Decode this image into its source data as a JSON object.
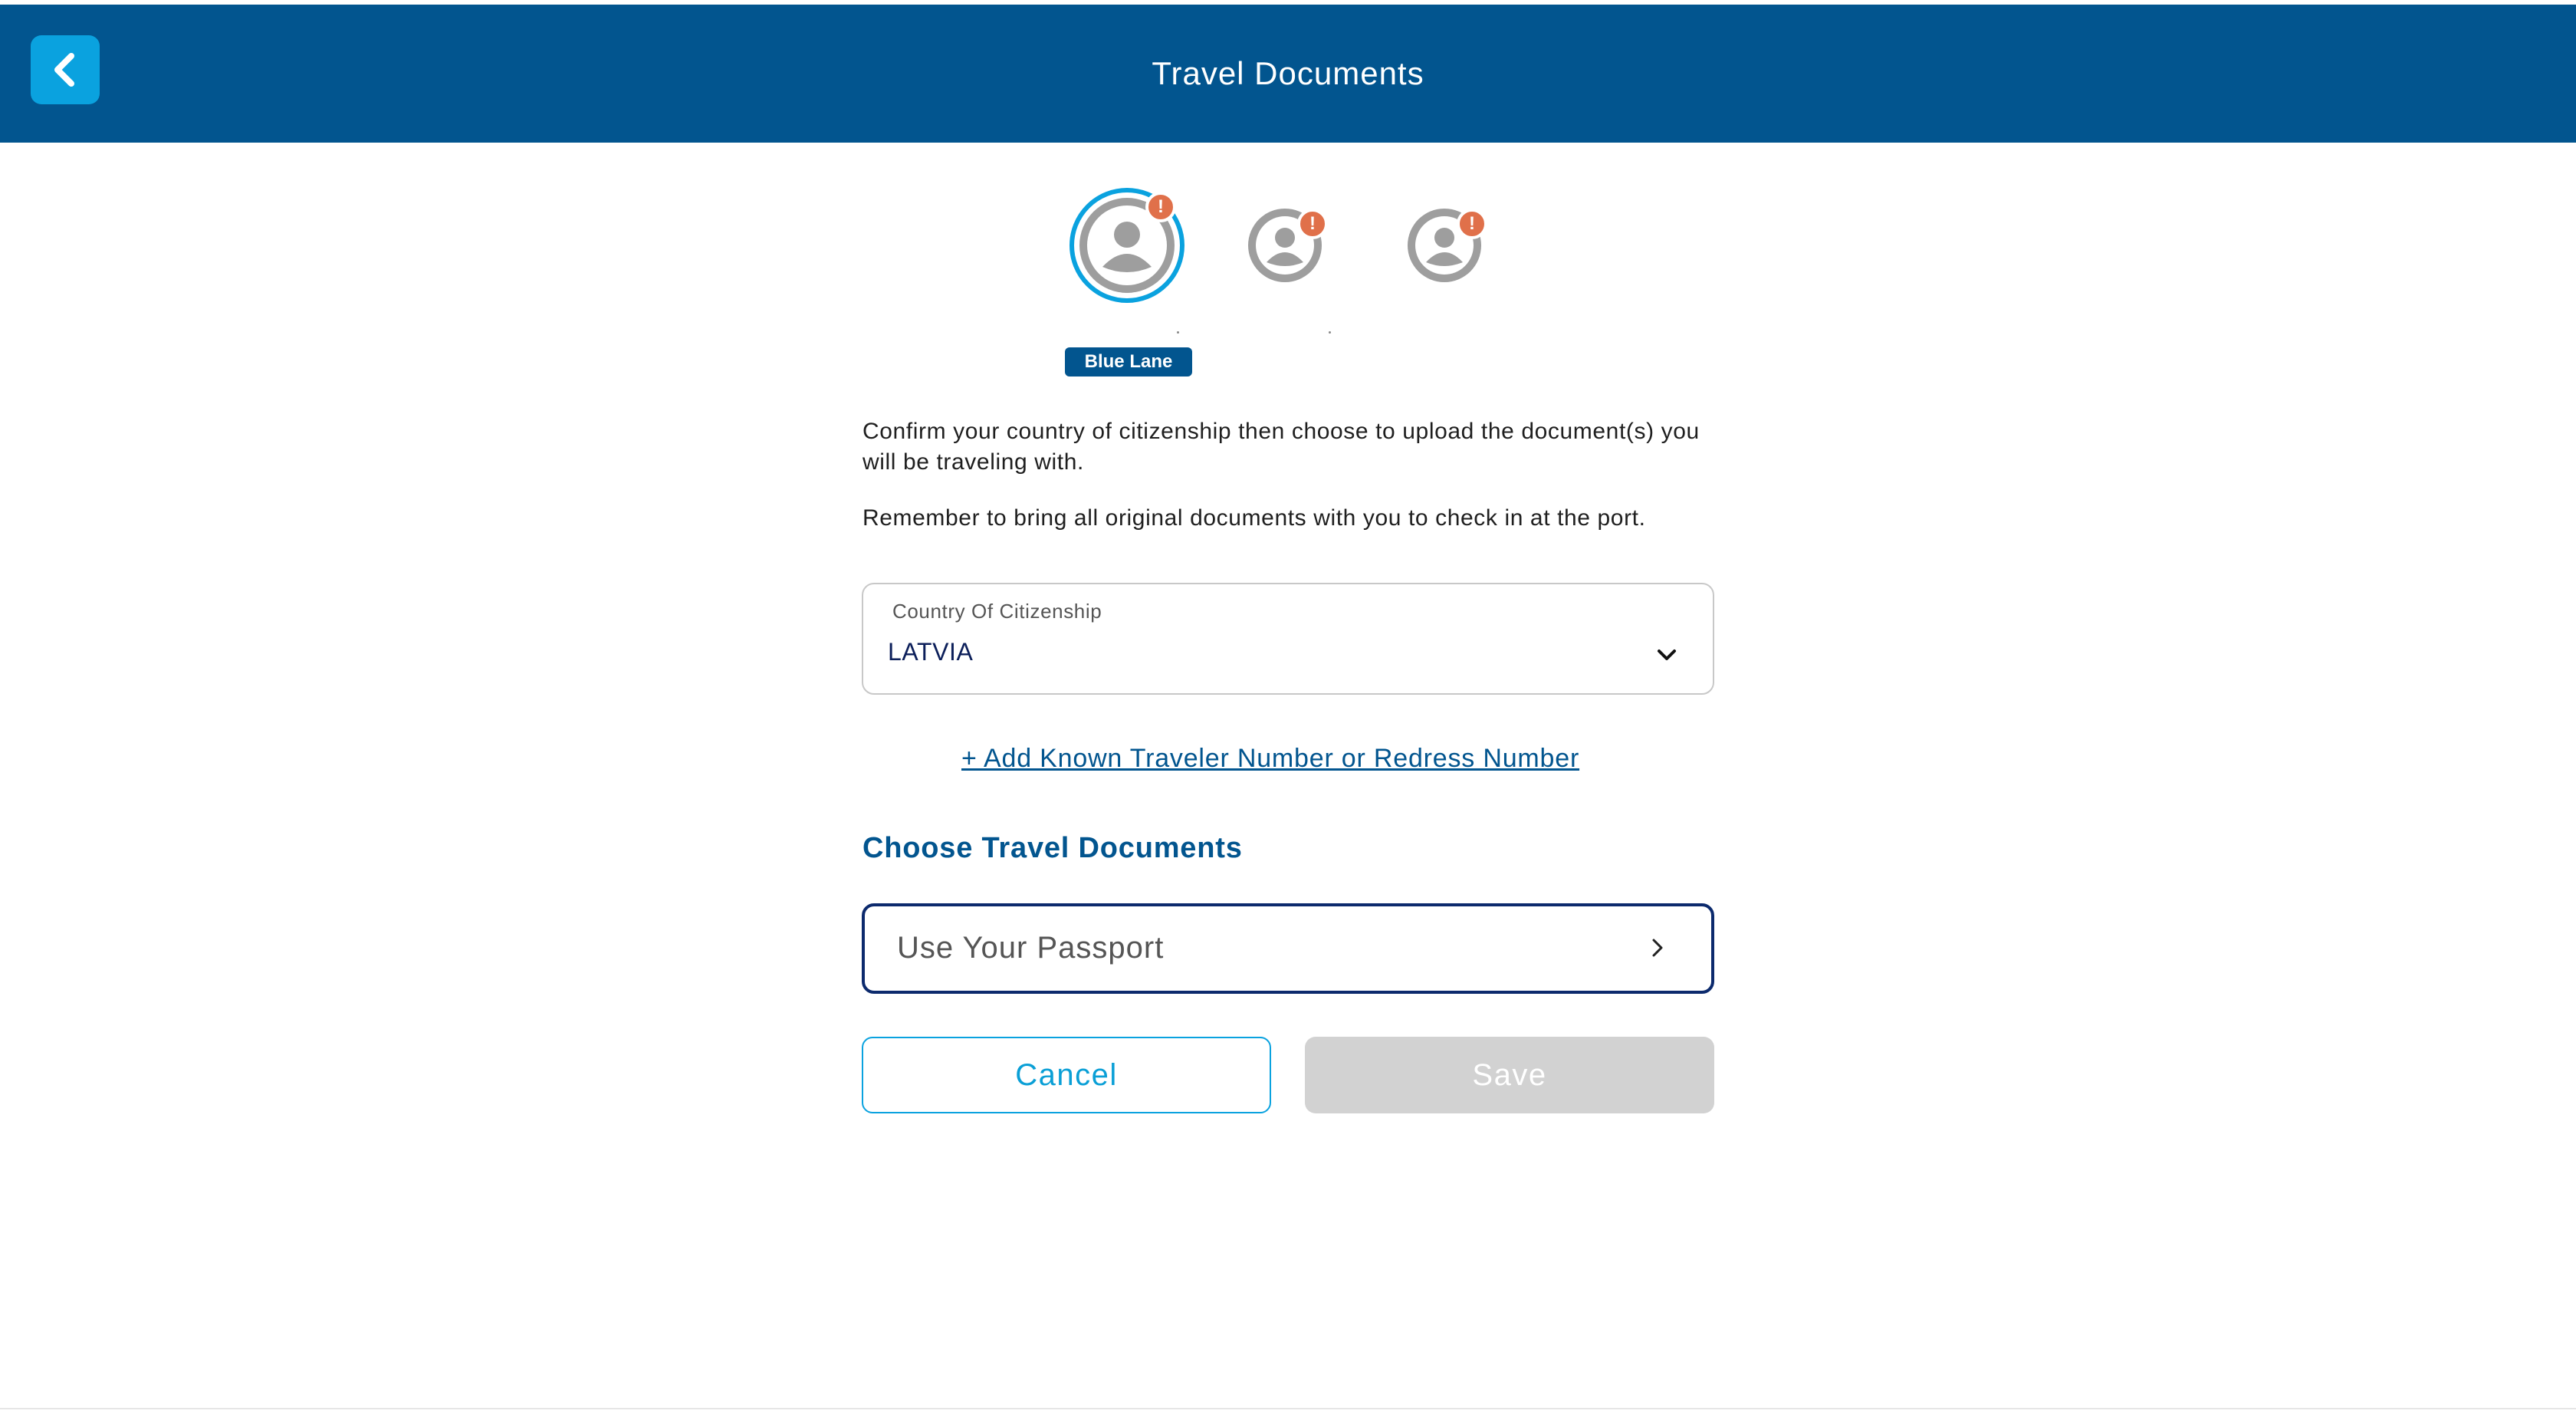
{
  "header": {
    "title": "Travel Documents",
    "back_icon": "chevron-left-icon"
  },
  "travelers": [
    {
      "selected": true,
      "alert": "!",
      "icon": "user-circle-icon"
    },
    {
      "selected": false,
      "alert": "!",
      "icon": "user-circle-icon"
    },
    {
      "selected": false,
      "alert": "!",
      "icon": "user-circle-icon"
    }
  ],
  "lane_badge": "Blue Lane",
  "instructions": {
    "line1": "Confirm your country of citizenship then choose to upload the document(s) you will be traveling with.",
    "line2": "Remember to bring all original documents with you to check in at the port."
  },
  "citizenship": {
    "label": "Country Of Citizenship",
    "value": "LATVIA"
  },
  "add_link": "+ Add Known Traveler Number or Redress Number",
  "documents": {
    "title": "Choose Travel Documents",
    "option": "Use Your Passport"
  },
  "actions": {
    "cancel": "Cancel",
    "save": "Save"
  },
  "colors": {
    "header": "#02558f",
    "accent": "#0aa2df",
    "alert": "#e0704a",
    "disabled": "#d2d2d2"
  }
}
